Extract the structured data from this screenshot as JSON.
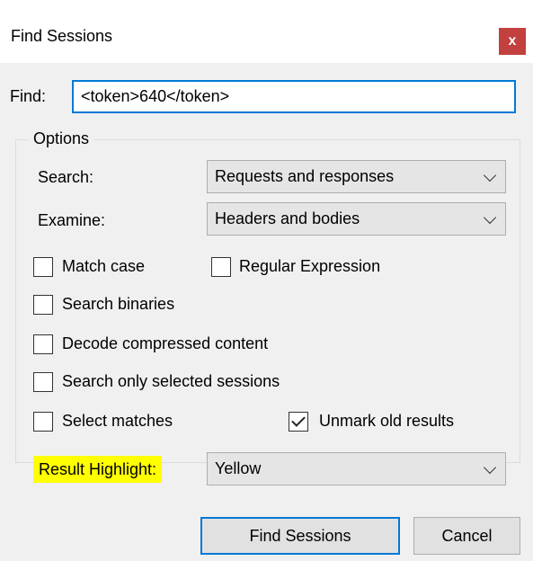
{
  "dialog": {
    "title": "Find Sessions",
    "close_label": "x"
  },
  "find": {
    "label": "Find:",
    "value": "<token>640</token>"
  },
  "options": {
    "legend": "Options",
    "search_label": "Search:",
    "search_value": "Requests and responses",
    "examine_label": "Examine:",
    "examine_value": "Headers and bodies",
    "checkboxes": {
      "match_case": {
        "label": "Match case",
        "checked": false
      },
      "regular_expression": {
        "label": "Regular Expression",
        "checked": false
      },
      "search_binaries": {
        "label": "Search binaries",
        "checked": false
      },
      "decode_compressed": {
        "label": "Decode compressed content",
        "checked": false
      },
      "search_selected": {
        "label": "Search only selected sessions",
        "checked": false
      },
      "select_matches": {
        "label": "Select matches",
        "checked": false
      },
      "unmark_old": {
        "label": "Unmark old results",
        "checked": true
      }
    },
    "result_highlight_label": "Result Highlight:",
    "result_highlight_value": "Yellow"
  },
  "buttons": {
    "find_sessions": "Find Sessions",
    "cancel": "Cancel"
  },
  "colors": {
    "highlight": "#ffff00",
    "accent": "#0078d7",
    "close": "#c2403d"
  }
}
